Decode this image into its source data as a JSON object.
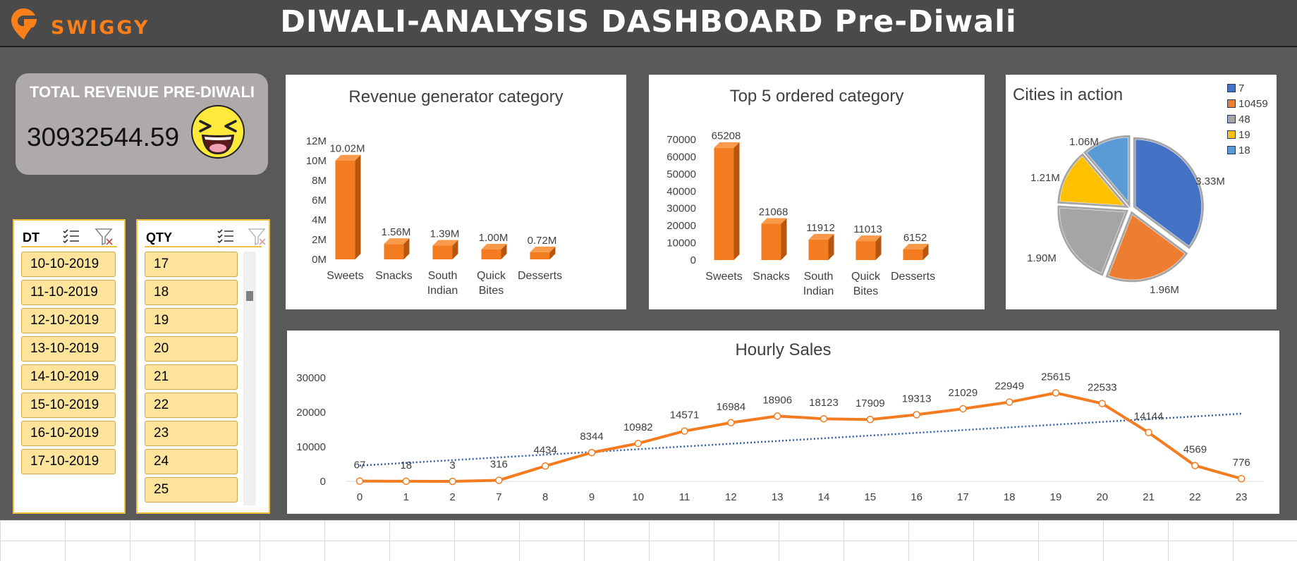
{
  "brand": {
    "name": "SWIGGY",
    "color": "#fc8019"
  },
  "title": "DIWALI-ANALYSIS DASHBOARD Pre-Diwali",
  "kpi": {
    "label": "TOTAL REVENUE PRE-DIWALI",
    "value": "30932544.59",
    "emoji": "laughing-face-icon"
  },
  "slicer_dt": {
    "title": "DT",
    "items": [
      "10-10-2019",
      "11-10-2019",
      "12-10-2019",
      "13-10-2019",
      "14-10-2019",
      "15-10-2019",
      "16-10-2019",
      "17-10-2019"
    ]
  },
  "slicer_qty": {
    "title": "QTY",
    "items": [
      "17",
      "18",
      "19",
      "20",
      "21",
      "22",
      "23",
      "24",
      "25"
    ]
  },
  "chart_data": [
    {
      "id": "revenue",
      "type": "bar",
      "title": "Revenue generator category",
      "categories": [
        [
          "Sweets"
        ],
        [
          "Snacks"
        ],
        [
          "South",
          "Indian"
        ],
        [
          "Quick",
          "Bites"
        ],
        [
          "Desserts"
        ]
      ],
      "values": [
        10.02,
        1.56,
        1.39,
        1.0,
        0.72
      ],
      "data_labels": [
        "10.02M",
        "1.56M",
        "1.39M",
        "1.00M",
        "0.72M"
      ],
      "yticks": [
        "0M",
        "2M",
        "4M",
        "6M",
        "8M",
        "10M",
        "12M"
      ],
      "ylim": [
        0,
        12
      ],
      "color": "#f47c20"
    },
    {
      "id": "orders",
      "type": "bar",
      "title": "Top 5 ordered category",
      "categories": [
        [
          "Sweets"
        ],
        [
          "Snacks"
        ],
        [
          "South",
          "Indian"
        ],
        [
          "Quick",
          "Bites"
        ],
        [
          "Desserts"
        ]
      ],
      "values": [
        65208,
        21068,
        11912,
        11013,
        6152
      ],
      "data_labels": [
        "65208",
        "21068",
        "11912",
        "11013",
        "6152"
      ],
      "yticks": [
        "0",
        "10000",
        "20000",
        "30000",
        "40000",
        "50000",
        "60000",
        "70000"
      ],
      "ylim": [
        0,
        70000
      ],
      "color": "#f47c20"
    },
    {
      "id": "cities",
      "type": "pie",
      "title": "Cities in action",
      "labels": [
        "7",
        "10459",
        "48",
        "19",
        "18"
      ],
      "values": [
        3.33,
        1.96,
        1.9,
        1.21,
        1.06
      ],
      "data_labels": [
        "3.33M",
        "1.96M",
        "1.90M",
        "1.21M",
        "1.06M"
      ],
      "colors": [
        "#4472c4",
        "#ed7d31",
        "#a5a5a5",
        "#ffc000",
        "#5b9bd5"
      ],
      "legend": "top-right"
    },
    {
      "id": "hourly",
      "type": "line",
      "title": "Hourly Sales",
      "x": [
        "0",
        "1",
        "2",
        "7",
        "8",
        "9",
        "10",
        "11",
        "12",
        "13",
        "14",
        "15",
        "16",
        "17",
        "18",
        "19",
        "20",
        "21",
        "22",
        "23"
      ],
      "values": [
        67,
        18,
        3,
        316,
        4434,
        8344,
        10982,
        14571,
        16984,
        18906,
        18123,
        17909,
        19313,
        21029,
        22949,
        25615,
        22533,
        14144,
        4569,
        776
      ],
      "yticks": [
        "0",
        "10000",
        "20000",
        "30000"
      ],
      "ylim": [
        0,
        30000
      ],
      "trendline": "linear",
      "color": "#f47c20",
      "trend_color": "#2e5fa8"
    }
  ]
}
